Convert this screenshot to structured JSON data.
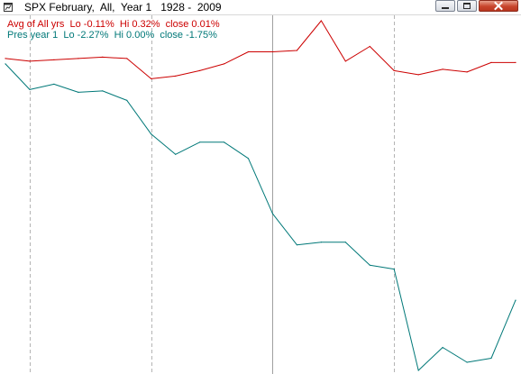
{
  "window": {
    "title": "SPX February,  All,  Year 1   1928 -  2009"
  },
  "colors": {
    "avg_series": "#cc0000",
    "pres_series": "#007878",
    "gridline_dashed": "#b4b4b4",
    "gridline_solid": "#a0a0a0"
  },
  "legend": {
    "avg": "Avg of All yrs  Lo -0.11%  Hi 0.32%  close 0.01%",
    "pres": "Pres year 1  Lo -2.27%  Hi 0.00%  close -1.75%"
  },
  "chart_data": {
    "type": "line",
    "x": [
      0,
      1,
      2,
      3,
      4,
      5,
      6,
      7,
      8,
      9,
      10,
      11,
      12,
      13,
      14,
      15,
      16,
      17,
      18,
      19,
      20,
      21
    ],
    "vertical_gridlines": [
      {
        "x": 1,
        "style": "dashed"
      },
      {
        "x": 6,
        "style": "dashed"
      },
      {
        "x": 11,
        "style": "solid"
      },
      {
        "x": 16,
        "style": "dashed"
      }
    ],
    "grid": false,
    "ylim": [
      -2.27,
      0.32
    ],
    "series": [
      {
        "name": "Avg of All yrs",
        "color": "#cc0000",
        "values": [
          0.04,
          0.02,
          0.03,
          0.04,
          0.05,
          0.04,
          -0.11,
          -0.09,
          -0.05,
          0.0,
          0.09,
          0.09,
          0.1,
          0.32,
          0.02,
          0.13,
          -0.05,
          -0.08,
          -0.04,
          -0.06,
          0.01,
          0.01
        ]
      },
      {
        "name": "Pres year 1",
        "color": "#007878",
        "values": [
          0.0,
          -0.19,
          -0.15,
          -0.21,
          -0.2,
          -0.27,
          -0.52,
          -0.67,
          -0.58,
          -0.58,
          -0.7,
          -1.11,
          -1.34,
          -1.32,
          -1.32,
          -1.49,
          -1.52,
          -2.27,
          -2.1,
          -2.21,
          -2.18,
          -1.75
        ]
      }
    ]
  }
}
